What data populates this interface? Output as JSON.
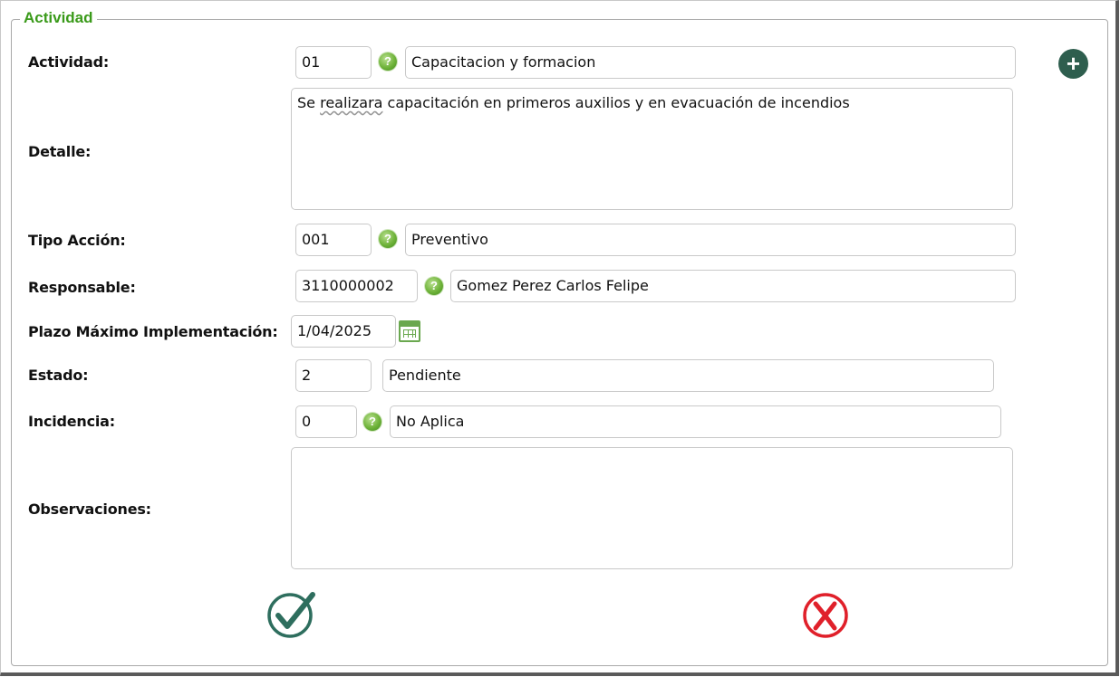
{
  "legend": "Actividad",
  "labels": {
    "actividad": "Actividad:",
    "detalle": "Detalle:",
    "tipo_accion": "Tipo Acción:",
    "responsable": "Responsable:",
    "plazo": "Plazo Máximo Implementación:",
    "estado": "Estado:",
    "incidencia": "Incidencia:",
    "observaciones": "Observaciones:"
  },
  "actividad": {
    "code": "01",
    "description": "Capacitacion y formacion"
  },
  "detalle": {
    "prefix": "Se ",
    "misspelled": "realizara",
    "suffix": " capacitación en primeros auxilios y en evacuación de incendios"
  },
  "tipo_accion": {
    "code": "001",
    "description": "Preventivo"
  },
  "responsable": {
    "code": "3110000002",
    "description": "Gomez Perez Carlos Felipe"
  },
  "plazo": {
    "date": "1/04/2025"
  },
  "estado": {
    "code": "2",
    "description": "Pendiente"
  },
  "incidencia": {
    "code": "0",
    "description": "No Aplica"
  },
  "observaciones": {
    "value": ""
  },
  "icons": {
    "help": "help-question-icon",
    "calendar": "calendar-icon",
    "add": "plus-circle-icon",
    "confirm": "checkmark-circle-icon",
    "cancel": "x-circle-icon"
  },
  "colors": {
    "legend": "#3a9a1a",
    "add": "#2e5e4e",
    "confirm": "#2e6e5e",
    "cancel": "#e0202a"
  }
}
